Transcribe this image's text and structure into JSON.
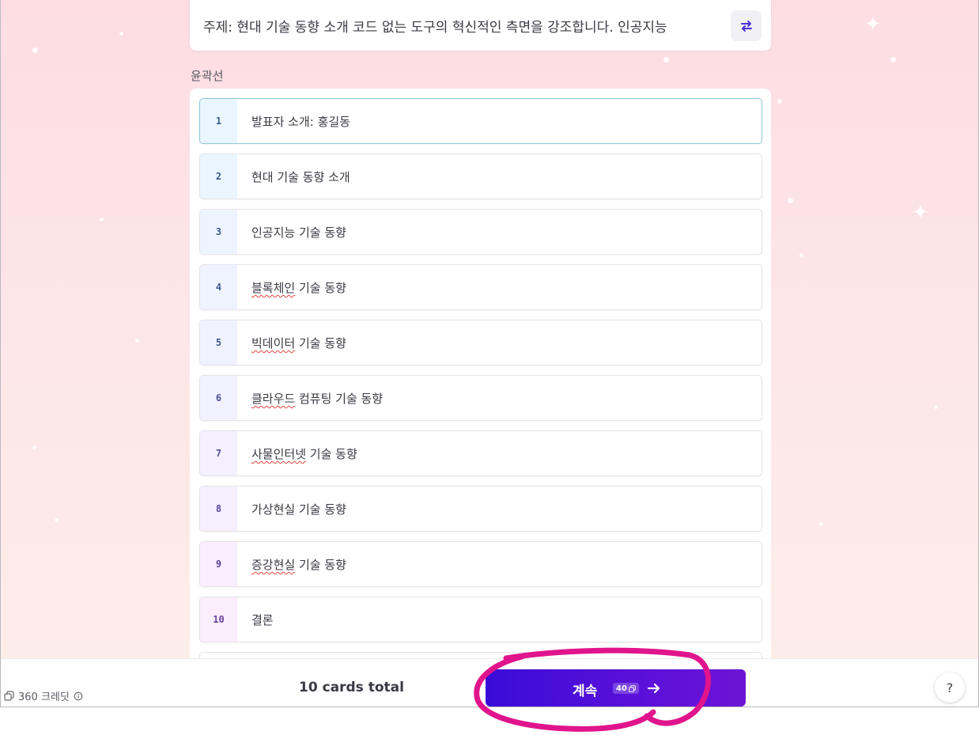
{
  "prompt": {
    "text": "주제: 현대 기술 동향 소개  코드 없는 도구의 혁신적인 측면을 강조합니다. 인공지능"
  },
  "outline": {
    "label": "윤곽선",
    "items": [
      {
        "num": "1",
        "text": "발표자 소개: 홍길동"
      },
      {
        "num": "2",
        "text": "현대 기술 동향 소개"
      },
      {
        "num": "3",
        "text": "인공지능 기술 동향"
      },
      {
        "num": "4",
        "text": "블록체인",
        "rest": " 기술 동향"
      },
      {
        "num": "5",
        "text": "빅데이터",
        "rest": " 기술 동향"
      },
      {
        "num": "6",
        "text": "클라우드",
        "rest": " 컴퓨팅 기술 동향"
      },
      {
        "num": "7",
        "text": "사물인터넷",
        "rest": " 기술 동향"
      },
      {
        "num": "8",
        "text": "가상현실 기술 동향"
      },
      {
        "num": "9",
        "text": "증강현실",
        "rest": " 기술 동향"
      },
      {
        "num": "10",
        "text": "결론"
      }
    ]
  },
  "footer": {
    "credits": "360 크레딧",
    "total": "10 cards total",
    "continue_label": "계속",
    "continue_cost": "40",
    "help": "?"
  },
  "colors": {
    "accent": "#4a0fd8",
    "annotation": "#e0148c"
  }
}
